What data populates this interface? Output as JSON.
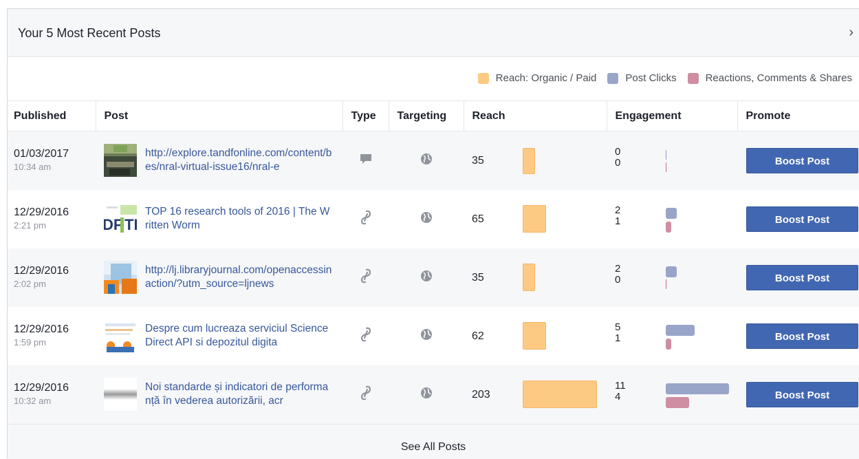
{
  "header": {
    "title": "Your 5 Most Recent Posts",
    "chevron": "›"
  },
  "legend": [
    {
      "label": "Reach: Organic / Paid",
      "color": "#fdca84"
    },
    {
      "label": "Post Clicks",
      "color": "#99a5c8"
    },
    {
      "label": "Reactions, Comments & Shares",
      "color": "#d08ea2"
    }
  ],
  "columns": {
    "published": "Published",
    "post": "Post",
    "type": "Type",
    "targeting": "Targeting",
    "reach": "Reach",
    "engagement": "Engagement",
    "promote": "Promote"
  },
  "rows": [
    {
      "date": "01/03/2017",
      "time": "10:34 am",
      "text": "http://explore.tandfonline.com/content/bes/nral-virtual-issue16/nral-e",
      "type_icon": "comment-icon",
      "targeting_icon": "globe-icon",
      "reach": "35",
      "clicks": "0",
      "reactions": "0",
      "button": "Boost Post"
    },
    {
      "date": "12/29/2016",
      "time": "2:21 pm",
      "text": "TOP 16 research tools of 2016 | The Written Worm",
      "type_icon": "link-icon",
      "targeting_icon": "globe-icon",
      "reach": "65",
      "clicks": "2",
      "reactions": "1",
      "button": "Boost Post"
    },
    {
      "date": "12/29/2016",
      "time": "2:02 pm",
      "text": "http://lj.libraryjournal.com/openaccessinaction/?utm_source=ljnews",
      "type_icon": "link-icon",
      "targeting_icon": "globe-icon",
      "reach": "35",
      "clicks": "2",
      "reactions": "0",
      "button": "Boost Post"
    },
    {
      "date": "12/29/2016",
      "time": "1:59 pm",
      "text": "Despre cum lucreaza serviciul Science Direct API si depozitul digita",
      "type_icon": "link-icon",
      "targeting_icon": "globe-icon",
      "reach": "62",
      "clicks": "5",
      "reactions": "1",
      "button": "Boost Post"
    },
    {
      "date": "12/29/2016",
      "time": "10:32 am",
      "text": "Noi standarde și indicatori de performanță în vederea autorizării, acr",
      "type_icon": "link-icon",
      "targeting_icon": "globe-icon",
      "reach": "203",
      "clicks": "11",
      "reactions": "4",
      "button": "Boost Post"
    }
  ],
  "footer": {
    "link": "See All Posts"
  }
}
